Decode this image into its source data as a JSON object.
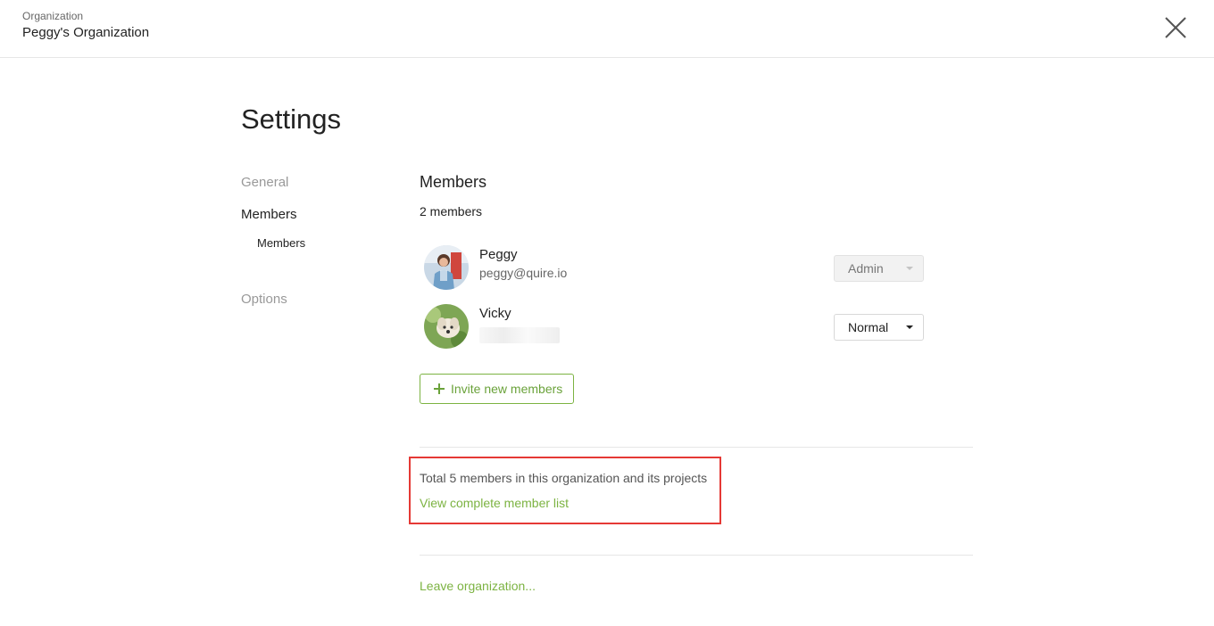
{
  "header": {
    "caption": "Organization",
    "org_name": "Peggy's Organization",
    "close_icon": "close-icon"
  },
  "page": {
    "title": "Settings"
  },
  "sidebar": {
    "items": [
      {
        "label": "General"
      },
      {
        "label": "Members"
      },
      {
        "label": "Members"
      },
      {
        "label": "Options"
      }
    ]
  },
  "members_section": {
    "title": "Members",
    "count_text": "2 members",
    "members": [
      {
        "name": "Peggy",
        "email": "peggy@quire.io",
        "role": "Admin"
      },
      {
        "name": "Vicky",
        "email": "",
        "role": "Normal"
      }
    ],
    "invite_label": "Invite new members",
    "invite_icon": "plus-icon"
  },
  "summary": {
    "total_text": "Total 5 members in this organization and its projects",
    "view_link": "View complete member list",
    "highlight_color": "#e53935"
  },
  "leave_link": "Leave organization...",
  "colors": {
    "accent": "#7cb342",
    "text": "#222222",
    "muted": "#999999"
  }
}
